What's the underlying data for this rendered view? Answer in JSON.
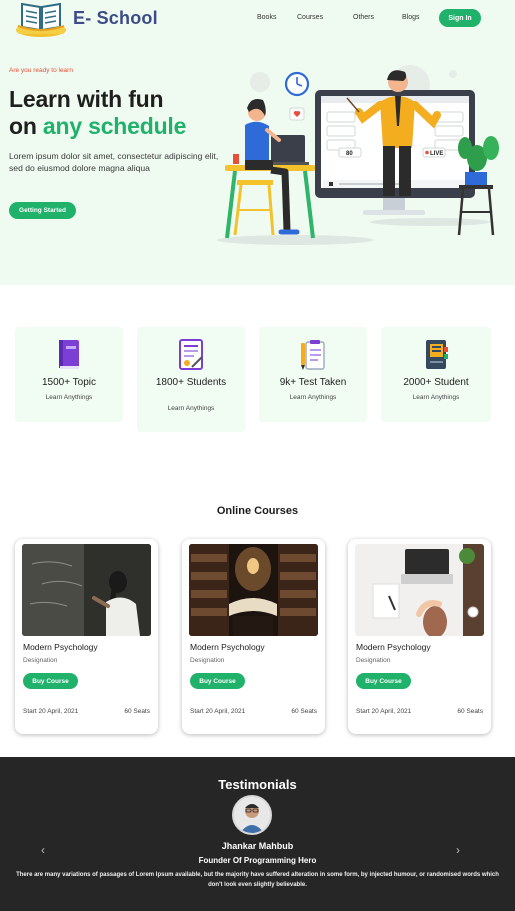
{
  "header": {
    "brand": "E- School",
    "nav": [
      "Books",
      "Courses",
      "Others",
      "Blogs"
    ],
    "signin_label": "Sign In"
  },
  "hero": {
    "eyebrow": "Are you ready to learn",
    "headline_line1": "Learn with fun",
    "headline_line2_prefix": "on ",
    "headline_accent": "any schedule",
    "description": "Lorem ipsum dolor sit amet, consectetur adipiscing elit, sed do eiusmod dolore magna aliqua",
    "cta_label": "Getting Started",
    "screen_badges": {
      "count": "80",
      "live": "LIVE"
    }
  },
  "stats": [
    {
      "title": "1500+ Topic",
      "subtitle": "Learn Anythings",
      "icon": "book-icon"
    },
    {
      "title": "1800+ Students",
      "subtitle": "Learn Anythings",
      "icon": "certificate-icon"
    },
    {
      "title": "9k+ Test Taken",
      "subtitle": "Learn Anythings",
      "icon": "clipboard-pen-icon"
    },
    {
      "title": "2000+ Student",
      "subtitle": "Learn Anythings",
      "icon": "notebook-icon"
    }
  ],
  "courses": {
    "title": "Online Courses",
    "items": [
      {
        "name": "Modern Psychology",
        "designation": "Designation",
        "button": "Buy Course",
        "start": "Start 20 April, 2021",
        "seats": "60 Seats",
        "image": "girl-at-blackboard"
      },
      {
        "name": "Modern Psychology",
        "designation": "Designation",
        "button": "Buy Course",
        "start": "Start 20 April, 2021",
        "seats": "60 Seats",
        "image": "library-open-book"
      },
      {
        "name": "Modern Psychology",
        "designation": "Designation",
        "button": "Buy Course",
        "start": "Start 20 April, 2021",
        "seats": "60 Seats",
        "image": "desk-with-laptop"
      }
    ]
  },
  "testimonials": {
    "title": "Testimonials",
    "name": "Jhankar Mahbub",
    "role": "Founder Of Programming Hero",
    "quote": "There are many variations of passages of Lorem Ipsum available, but the majority have suffered alteration in some form, by injected humour, or randomised words which don't look even slightly believable.",
    "prev_icon": "chevron-left-icon",
    "next_icon": "chevron-right-icon"
  },
  "colors": {
    "accent": "#20b26b",
    "hero_bg": "#effbf1",
    "card_bg": "#f1fcf3",
    "brand_text": "#3d4b86",
    "eyebrow": "#e6503a",
    "footer_bg": "#262626"
  }
}
